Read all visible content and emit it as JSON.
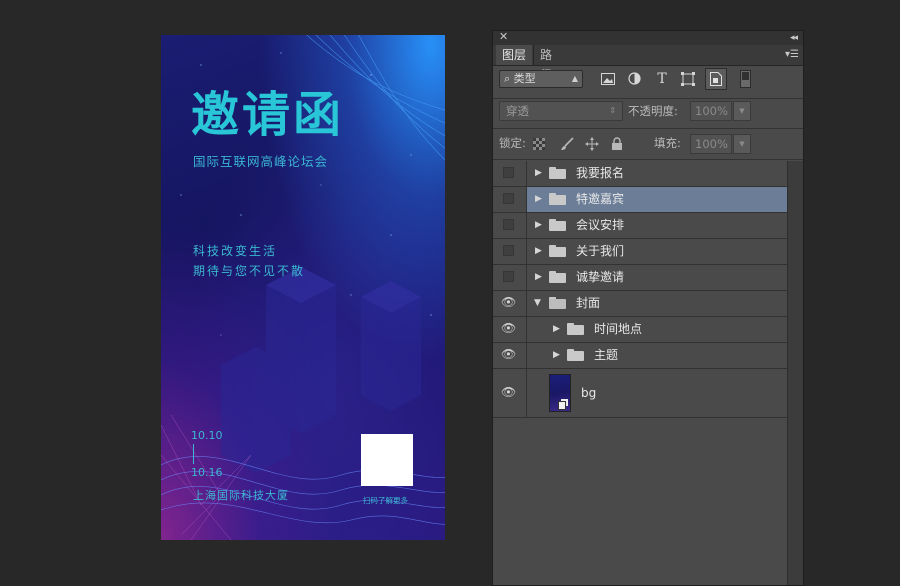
{
  "poster": {
    "title": "邀请函",
    "subtitle": "国际互联网高峰论坛会",
    "slogan_line1": "科技改变生活",
    "slogan_line2": "期待与您不见不散",
    "date_start": "10.10",
    "date_end": "10.16",
    "venue": "上海国际科技大厦",
    "qr_label": "扫码了解更多",
    "colors": {
      "accent": "#29c6d8",
      "background": "#1a1d72"
    }
  },
  "panel": {
    "close_glyph": "✕",
    "collapse_glyph": "◂◂",
    "menu_glyph": "▾☰",
    "tabs": [
      {
        "label": "图层",
        "active": true
      },
      {
        "label": "路径",
        "active": false
      }
    ],
    "filter": {
      "kind_label": "类型",
      "search_glyph": "⌕",
      "icons": [
        "image-filter-icon",
        "adjustment-filter-icon",
        "text-filter-icon",
        "shape-filter-icon",
        "smart-object-filter-icon"
      ],
      "text_glyph": "T"
    },
    "blend_mode": "穿透",
    "opacity_label": "不透明度:",
    "opacity_value": "100%",
    "lock_label": "锁定:",
    "fill_label": "填充:",
    "fill_value": "100%",
    "layers": [
      {
        "name": "我要报名",
        "visible": false,
        "type": "group",
        "expanded": false,
        "selected": false
      },
      {
        "name": "特邀嘉宾",
        "visible": false,
        "type": "group",
        "expanded": false,
        "selected": true
      },
      {
        "name": "会议安排",
        "visible": false,
        "type": "group",
        "expanded": false,
        "selected": false
      },
      {
        "name": "关于我们",
        "visible": false,
        "type": "group",
        "expanded": false,
        "selected": false
      },
      {
        "name": "诚挚邀请",
        "visible": false,
        "type": "group",
        "expanded": false,
        "selected": false
      },
      {
        "name": "封面",
        "visible": true,
        "type": "group",
        "expanded": true,
        "selected": false
      },
      {
        "name": "时间地点",
        "visible": true,
        "type": "group",
        "expanded": false,
        "selected": false,
        "indent": 1
      },
      {
        "name": "主题",
        "visible": true,
        "type": "group",
        "expanded": false,
        "selected": false,
        "indent": 1
      },
      {
        "name": "bg",
        "visible": true,
        "type": "smart-object",
        "selected": false
      }
    ]
  }
}
